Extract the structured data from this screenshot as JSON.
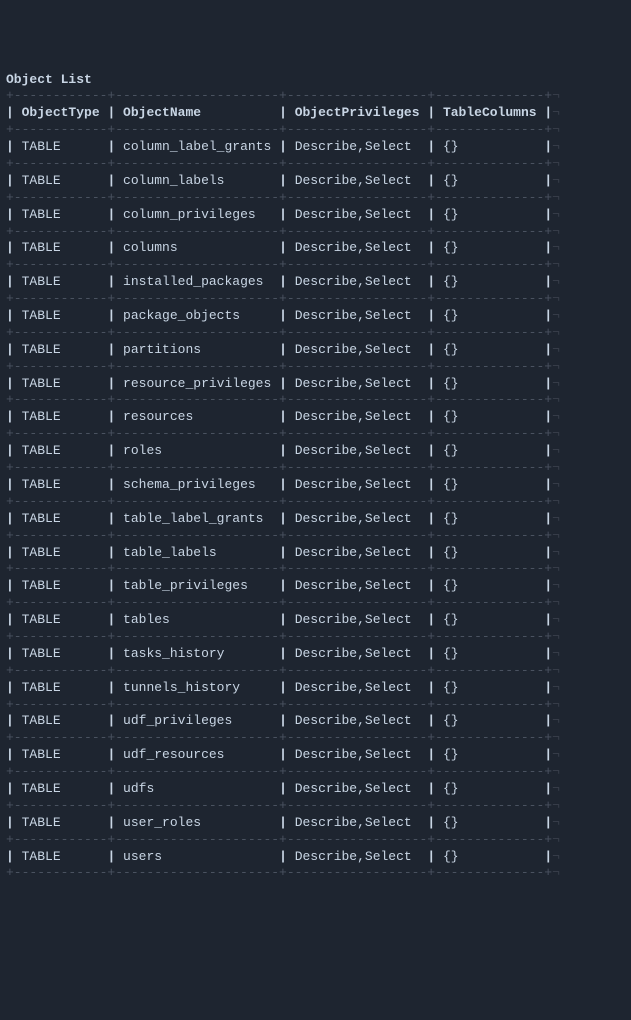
{
  "title": "Object List",
  "columns": [
    "ObjectType",
    "ObjectName",
    "ObjectPrivileges",
    "TableColumns"
  ],
  "rows": [
    {
      "type": "TABLE",
      "name": "column_label_grants",
      "privs": "Describe,Select",
      "cols": "{}"
    },
    {
      "type": "TABLE",
      "name": "column_labels",
      "privs": "Describe,Select",
      "cols": "{}"
    },
    {
      "type": "TABLE",
      "name": "column_privileges",
      "privs": "Describe,Select",
      "cols": "{}"
    },
    {
      "type": "TABLE",
      "name": "columns",
      "privs": "Describe,Select",
      "cols": "{}"
    },
    {
      "type": "TABLE",
      "name": "installed_packages",
      "privs": "Describe,Select",
      "cols": "{}"
    },
    {
      "type": "TABLE",
      "name": "package_objects",
      "privs": "Describe,Select",
      "cols": "{}"
    },
    {
      "type": "TABLE",
      "name": "partitions",
      "privs": "Describe,Select",
      "cols": "{}"
    },
    {
      "type": "TABLE",
      "name": "resource_privileges",
      "privs": "Describe,Select",
      "cols": "{}"
    },
    {
      "type": "TABLE",
      "name": "resources",
      "privs": "Describe,Select",
      "cols": "{}"
    },
    {
      "type": "TABLE",
      "name": "roles",
      "privs": "Describe,Select",
      "cols": "{}"
    },
    {
      "type": "TABLE",
      "name": "schema_privileges",
      "privs": "Describe,Select",
      "cols": "{}"
    },
    {
      "type": "TABLE",
      "name": "table_label_grants",
      "privs": "Describe,Select",
      "cols": "{}"
    },
    {
      "type": "TABLE",
      "name": "table_labels",
      "privs": "Describe,Select",
      "cols": "{}"
    },
    {
      "type": "TABLE",
      "name": "table_privileges",
      "privs": "Describe,Select",
      "cols": "{}"
    },
    {
      "type": "TABLE",
      "name": "tables",
      "privs": "Describe,Select",
      "cols": "{}"
    },
    {
      "type": "TABLE",
      "name": "tasks_history",
      "privs": "Describe,Select",
      "cols": "{}"
    },
    {
      "type": "TABLE",
      "name": "tunnels_history",
      "privs": "Describe,Select",
      "cols": "{}"
    },
    {
      "type": "TABLE",
      "name": "udf_privileges",
      "privs": "Describe,Select",
      "cols": "{}"
    },
    {
      "type": "TABLE",
      "name": "udf_resources",
      "privs": "Describe,Select",
      "cols": "{}"
    },
    {
      "type": "TABLE",
      "name": "udfs",
      "privs": "Describe,Select",
      "cols": "{}"
    },
    {
      "type": "TABLE",
      "name": "user_roles",
      "privs": "Describe,Select",
      "cols": "{}"
    },
    {
      "type": "TABLE",
      "name": "users",
      "privs": "Describe,Select",
      "cols": "{}"
    }
  ],
  "widths": {
    "type": 12,
    "name": 21,
    "privs": 18,
    "cols": 14
  }
}
